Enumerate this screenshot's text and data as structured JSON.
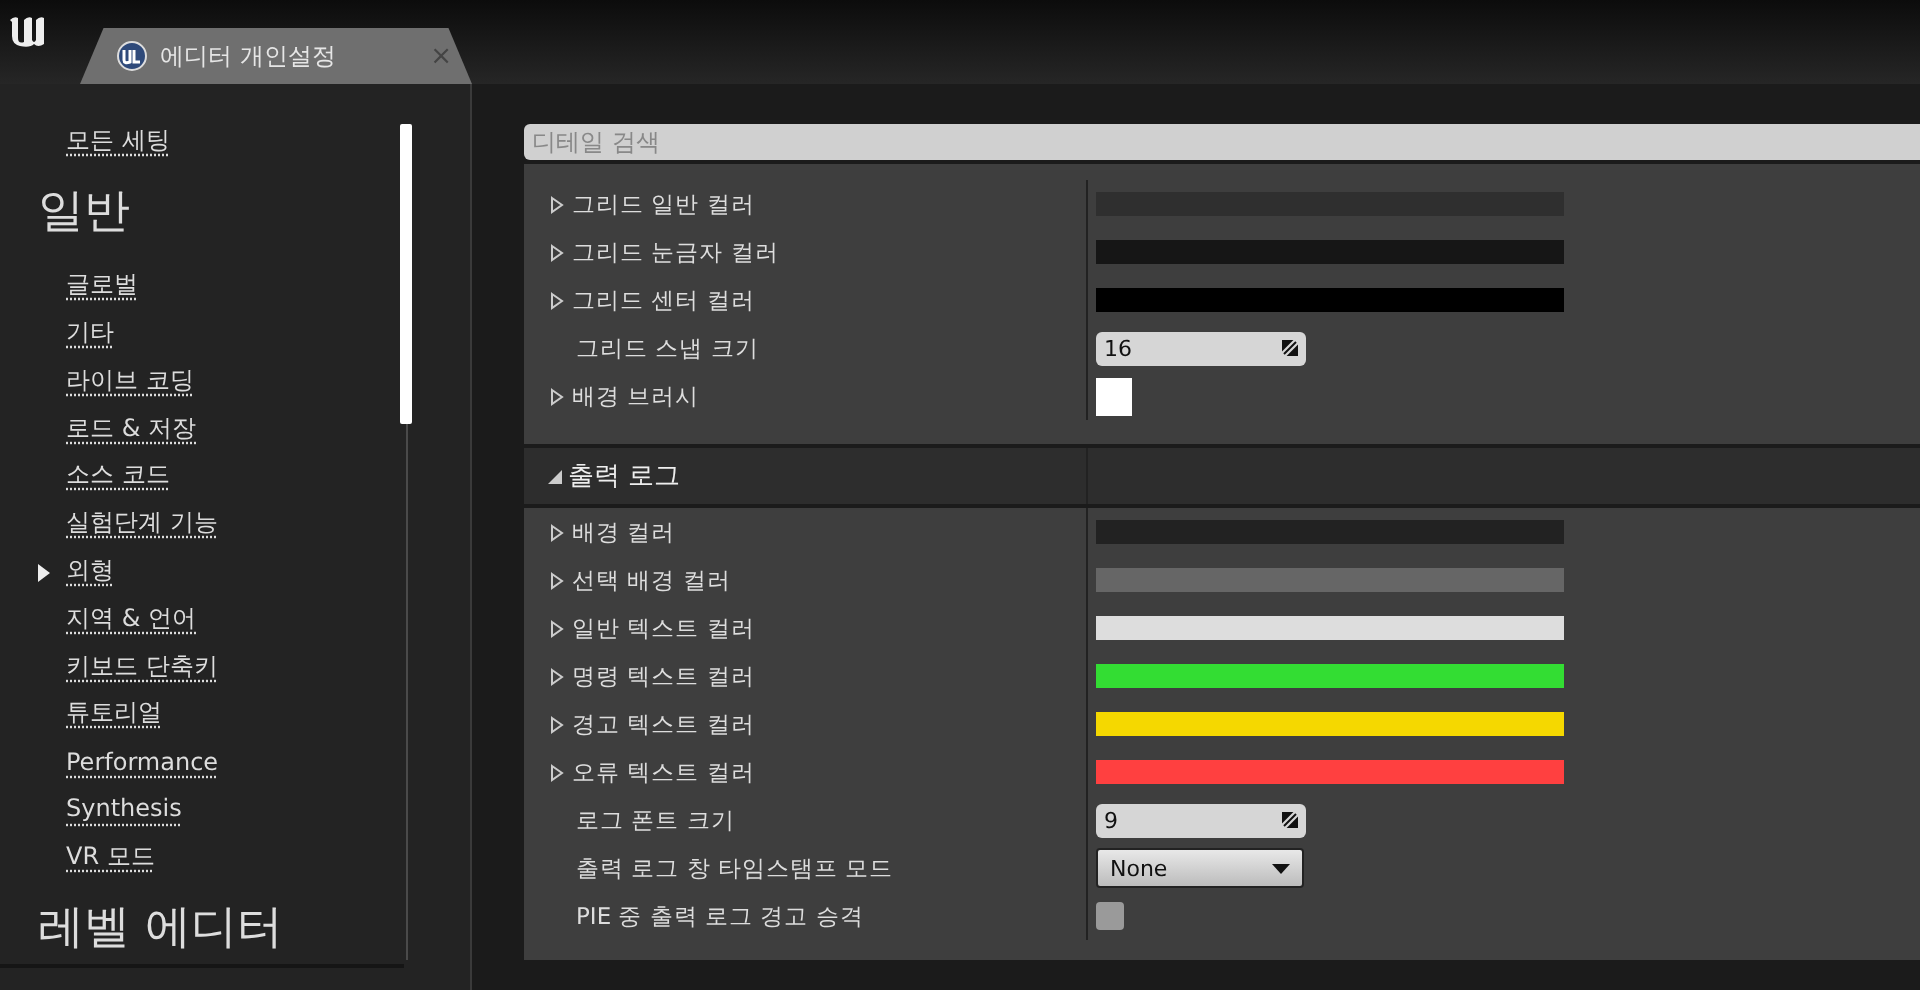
{
  "window": {
    "tab": {
      "title": "에디터 개인설정",
      "close": "×"
    }
  },
  "sidebar": {
    "items": [
      {
        "kind": "link",
        "label": "모든 세팅",
        "selected": false
      },
      {
        "kind": "heading",
        "label": "일반"
      },
      {
        "kind": "link",
        "label": "글로벌",
        "selected": false
      },
      {
        "kind": "link",
        "label": "기타",
        "selected": false
      },
      {
        "kind": "link",
        "label": "라이브 코딩",
        "selected": false
      },
      {
        "kind": "link",
        "label": "로드 & 저장",
        "selected": false
      },
      {
        "kind": "link",
        "label": "소스 코드",
        "selected": false
      },
      {
        "kind": "link",
        "label": "실험단계 기능",
        "selected": false
      },
      {
        "kind": "link",
        "label": "외형",
        "selected": true
      },
      {
        "kind": "link",
        "label": "지역 & 언어",
        "selected": false
      },
      {
        "kind": "link",
        "label": "키보드 단축키",
        "selected": false
      },
      {
        "kind": "link",
        "label": "튜토리얼",
        "selected": false
      },
      {
        "kind": "link",
        "label": "Performance",
        "selected": false
      },
      {
        "kind": "link",
        "label": "Synthesis",
        "selected": false
      },
      {
        "kind": "link",
        "label": "VR 모드",
        "selected": false
      },
      {
        "kind": "heading",
        "label": "레벨 에디터"
      }
    ]
  },
  "details": {
    "search": {
      "placeholder": "디테일 검색"
    },
    "groups": [
      {
        "rows": [
          {
            "label": "그리드 일반 컬러",
            "kind": "color",
            "expanded": false,
            "color": "#2f2f2f"
          },
          {
            "label": "그리드 눈금자 컬러",
            "kind": "color",
            "expanded": false,
            "color": "#161616"
          },
          {
            "label": "그리드 센터 컬러",
            "kind": "color",
            "expanded": false,
            "color": "#000000"
          },
          {
            "label": "그리드 스냅 크기",
            "kind": "number",
            "value": "16"
          },
          {
            "label": "배경 브러시",
            "kind": "brush",
            "expanded": false,
            "color": "#ffffff"
          }
        ]
      },
      {
        "title": "출력 로그",
        "expanded": true,
        "rows": [
          {
            "label": "배경 컬러",
            "kind": "color",
            "expanded": false,
            "color": "#222222"
          },
          {
            "label": "선택 배경 컬러",
            "kind": "color",
            "expanded": false,
            "color": "#666666"
          },
          {
            "label": "일반 텍스트 컬러",
            "kind": "color",
            "expanded": false,
            "color": "#dddddd"
          },
          {
            "label": "명령 텍스트 컬러",
            "kind": "color",
            "expanded": false,
            "color": "#33dd33"
          },
          {
            "label": "경고 텍스트 컬러",
            "kind": "color",
            "expanded": false,
            "color": "#f5d800"
          },
          {
            "label": "오류 텍스트 컬러",
            "kind": "color",
            "expanded": false,
            "color": "#ff4040"
          },
          {
            "label": "로그 폰트 크기",
            "kind": "number",
            "value": "9"
          },
          {
            "label": "출력 로그 창 타임스탬프 모드",
            "kind": "dropdown",
            "value": "None"
          },
          {
            "label": "PIE 중 출력 로그 경고 승격",
            "kind": "checkbox",
            "checked": false
          }
        ]
      }
    ]
  }
}
